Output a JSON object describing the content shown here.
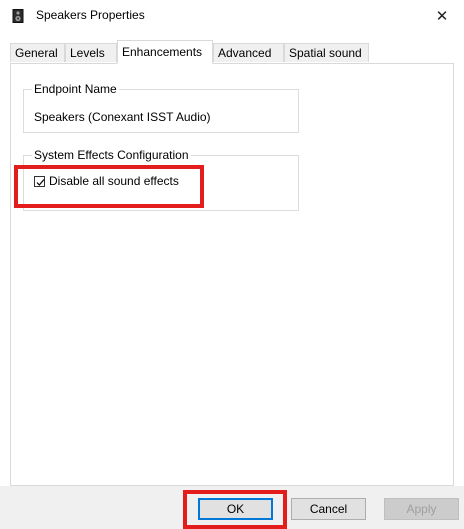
{
  "window": {
    "title": "Speakers Properties",
    "close_glyph": "✕",
    "icon": "speaker-icon"
  },
  "tabs": [
    {
      "label": "General",
      "active": false
    },
    {
      "label": "Levels",
      "active": false
    },
    {
      "label": "Enhancements",
      "active": true
    },
    {
      "label": "Advanced",
      "active": false
    },
    {
      "label": "Spatial sound",
      "active": false
    }
  ],
  "endpoint": {
    "legend": "Endpoint Name",
    "value": "Speakers (Conexant ISST Audio)"
  },
  "system_effects": {
    "legend": "System Effects Configuration",
    "checkbox_label": "Disable all sound effects",
    "checked": true
  },
  "buttons": {
    "ok": "OK",
    "cancel": "Cancel",
    "apply": "Apply"
  },
  "colors": {
    "highlight": "#e31c1c",
    "default_button_border": "#0078d7"
  }
}
